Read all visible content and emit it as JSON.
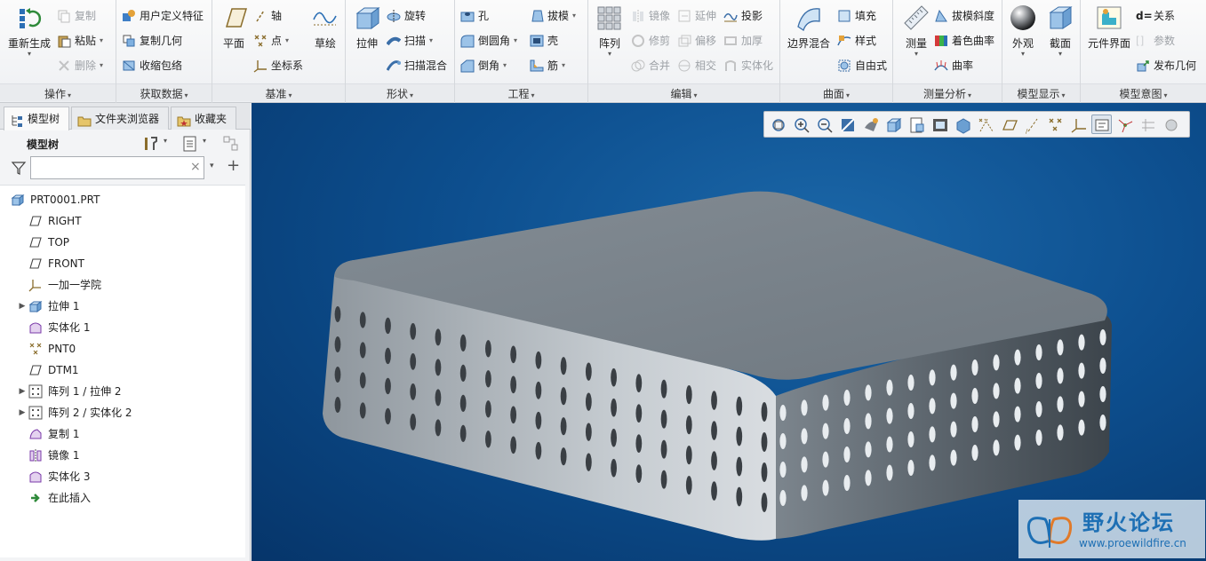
{
  "ribbon": {
    "groups": {
      "operate": {
        "label": "操作",
        "regenerate": "重新生成",
        "copy": "复制",
        "paste": "粘贴",
        "delete": "删除"
      },
      "getdata": {
        "label": "获取数据",
        "udf": "用户定义特征",
        "copy_geom": "复制几何",
        "shrinkwrap": "收缩包络"
      },
      "datum": {
        "label": "基准",
        "plane": "平面",
        "axis": "轴",
        "point": "点",
        "csys": "坐标系",
        "sketch": "草绘"
      },
      "shapes": {
        "label": "形状",
        "extrude": "拉伸",
        "revolve": "旋转",
        "sweep": "扫描",
        "swept_blend": "扫描混合"
      },
      "engineering": {
        "label": "工程",
        "hole": "孔",
        "round": "倒圆角",
        "chamfer": "倒角",
        "draft": "拔模",
        "shell": "壳",
        "rib": "筋"
      },
      "editing": {
        "label": "编辑",
        "pattern": "阵列",
        "mirror": "镜像",
        "extend": "延伸",
        "project": "投影",
        "trim": "修剪",
        "offset": "偏移",
        "thicken": "加厚",
        "merge": "合并",
        "intersect": "相交",
        "solidify": "实体化"
      },
      "surfaces": {
        "label": "曲面",
        "boundary_blend": "边界混合",
        "fill": "填充",
        "style": "样式",
        "freestyle": "自由式"
      },
      "analysis": {
        "label": "测量分析",
        "measure": "测量",
        "draft_analysis": "拔模斜度",
        "shade_curvature": "着色曲率",
        "curvature": "曲率"
      },
      "display": {
        "label": "模型显示",
        "appearance": "外观",
        "section": "截面"
      },
      "intent": {
        "label": "模型意图",
        "component_interface": "元件界面",
        "relations": "关系",
        "parameters": "参数",
        "publish_geom": "发布几何",
        "relations_prefix": "d="
      }
    }
  },
  "left_panel": {
    "tabs": [
      "模型树",
      "文件夹浏览器",
      "收藏夹"
    ],
    "title": "模型树",
    "search": {
      "value": "",
      "placeholder": ""
    },
    "tree": [
      {
        "label": "PRT0001.PRT",
        "icon": "part-icon",
        "expandable": false
      },
      {
        "label": "RIGHT",
        "icon": "datum-plane-icon",
        "expandable": false
      },
      {
        "label": "TOP",
        "icon": "datum-plane-icon",
        "expandable": false
      },
      {
        "label": "FRONT",
        "icon": "datum-plane-icon",
        "expandable": false
      },
      {
        "label": "一加一学院",
        "icon": "csys-icon",
        "expandable": false
      },
      {
        "label": "拉伸 1",
        "icon": "extrude-icon",
        "expandable": true
      },
      {
        "label": "实体化 1",
        "icon": "solidify-icon",
        "expandable": false
      },
      {
        "label": "PNT0",
        "icon": "datum-point-icon",
        "expandable": false
      },
      {
        "label": "DTM1",
        "icon": "datum-plane-icon",
        "expandable": false
      },
      {
        "label": "阵列 1 / 拉伸 2",
        "icon": "pattern-icon",
        "expandable": true
      },
      {
        "label": "阵列 2 / 实体化 2",
        "icon": "pattern-icon",
        "expandable": true
      },
      {
        "label": "复制 1",
        "icon": "copy-icon",
        "expandable": false
      },
      {
        "label": "镜像 1",
        "icon": "mirror-icon",
        "expandable": false
      },
      {
        "label": "实体化 3",
        "icon": "solidify-icon",
        "expandable": false
      },
      {
        "label": "在此插入",
        "icon": "insert-here-icon",
        "expandable": false
      }
    ]
  },
  "viewport": {
    "watermark_text": "野火论坛",
    "watermark_url": "www.proewildfire.cn"
  },
  "colors": {
    "viewport_bg": "#0d4f8f",
    "model_top": "#7d868e",
    "model_side": "#a8b0b7",
    "accent": "#1f7bc4"
  }
}
